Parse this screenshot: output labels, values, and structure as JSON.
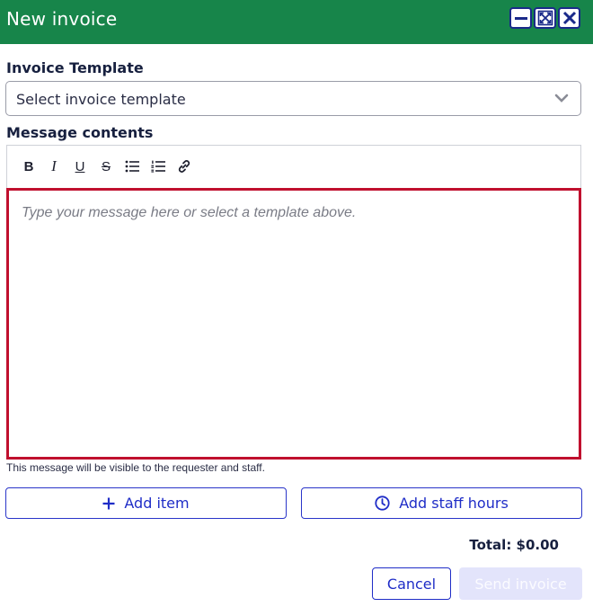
{
  "window": {
    "title": "New invoice",
    "controls": [
      "minimize-icon",
      "maximize-icon",
      "close-icon"
    ],
    "colors": {
      "titlebar": "#17854a"
    }
  },
  "template": {
    "label": "Invoice Template",
    "placeholder": "Select invoice template"
  },
  "message": {
    "label": "Message contents",
    "toolbar": [
      {
        "name": "bold-icon",
        "glyph": "B"
      },
      {
        "name": "italic-icon",
        "glyph": "I"
      },
      {
        "name": "underline-icon",
        "glyph": "U"
      },
      {
        "name": "strikethrough-icon",
        "glyph": "S"
      },
      {
        "name": "bullet-list-icon",
        "glyph": ""
      },
      {
        "name": "numbered-list-icon",
        "glyph": ""
      },
      {
        "name": "link-icon",
        "glyph": ""
      }
    ],
    "placeholder": "Type your message here or select a template above.",
    "hint": "This message will be visible to the requester and staff.",
    "colors": {
      "editor_border": "#c0102e"
    }
  },
  "actions": {
    "add_item": "Add item",
    "add_staff_hours": "Add staff hours"
  },
  "summary": {
    "total": "Total: $0.00"
  },
  "footer": {
    "cancel": "Cancel",
    "send": "Send invoice",
    "colors": {
      "accent": "#1f2dc7",
      "disabled_bg": "#e3e4fb"
    }
  }
}
